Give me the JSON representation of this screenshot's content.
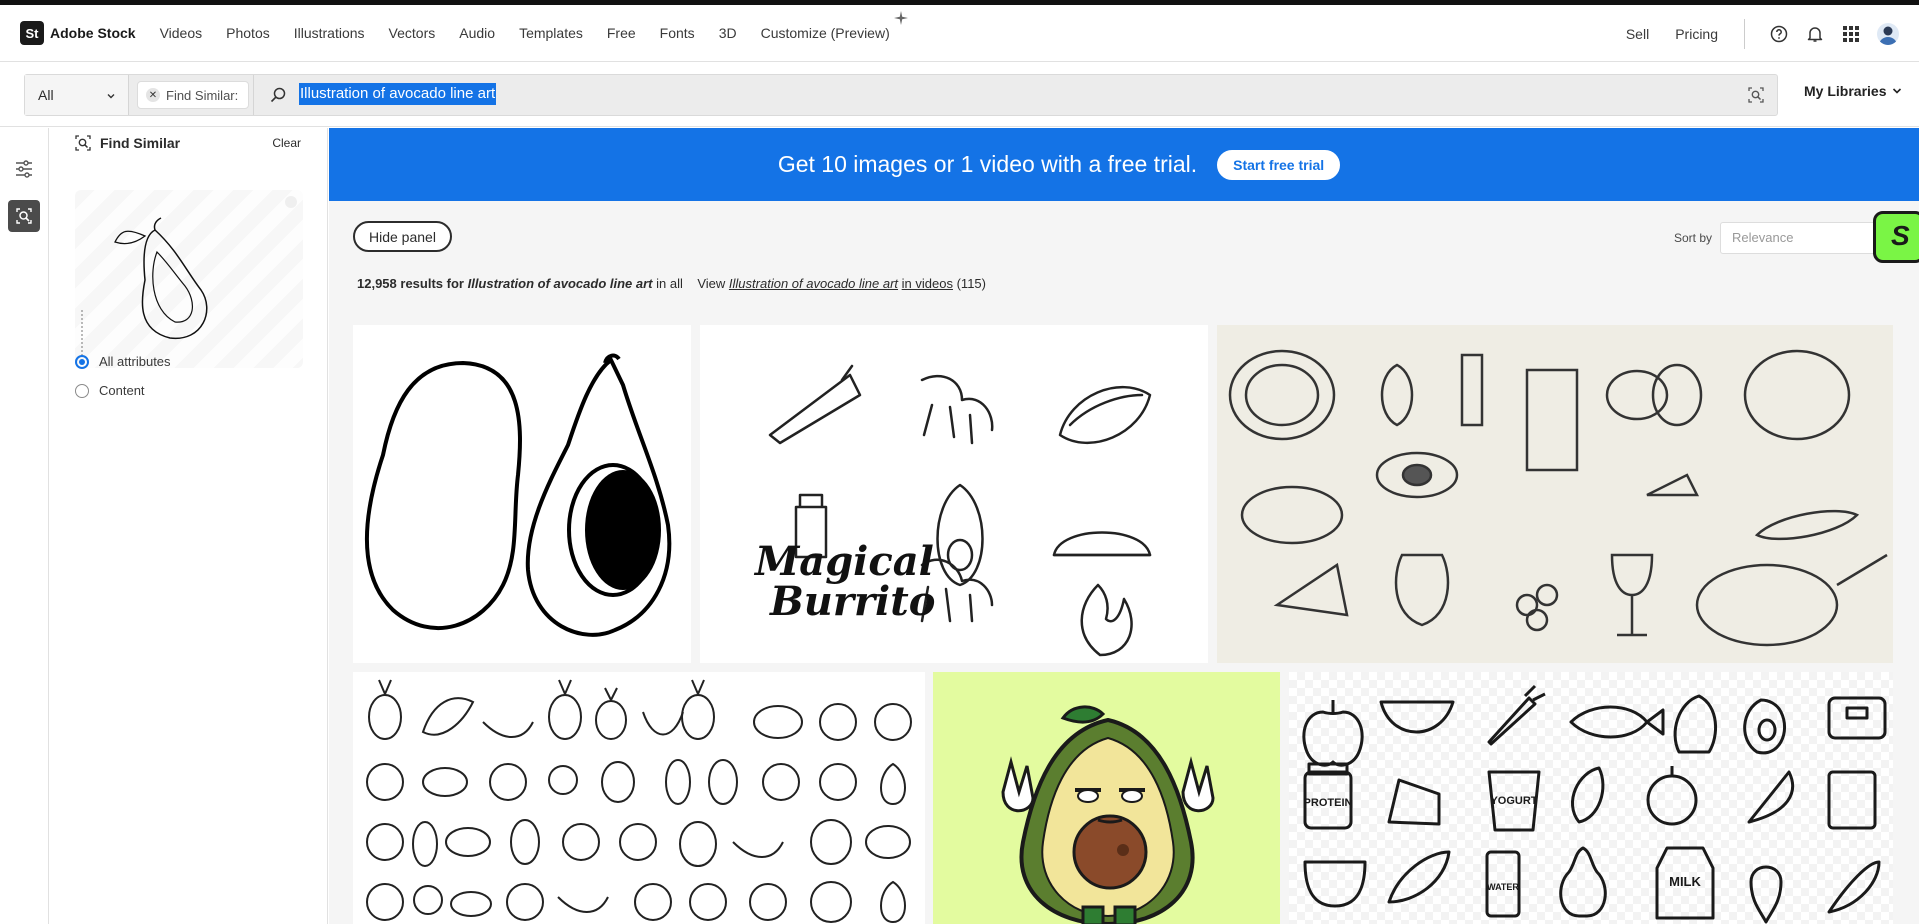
{
  "header": {
    "logo_mark": "St",
    "logo_text": "Adobe Stock",
    "nav": [
      "Videos",
      "Photos",
      "Illustrations",
      "Vectors",
      "Audio",
      "Templates",
      "Free",
      "Fonts",
      "3D",
      "Customize (Preview)"
    ],
    "sell": "Sell",
    "pricing": "Pricing",
    "icons": [
      "help-icon",
      "bell-icon",
      "apps-grid-icon",
      "avatar"
    ]
  },
  "search": {
    "scope": "All",
    "chip_label": "Find Similar:",
    "query": "Illustration of avocado line art",
    "my_libraries": "My Libraries"
  },
  "panel": {
    "title": "Find Similar",
    "clear": "Clear",
    "options": [
      {
        "label": "All attributes",
        "selected": true
      },
      {
        "label": "Content",
        "selected": false
      }
    ]
  },
  "banner": {
    "text": "Get 10 images or 1 video with a free trial.",
    "button": "Start free trial",
    "color": "#1473e6"
  },
  "toolbar": {
    "hide_panel": "Hide panel",
    "sort_label": "Sort by",
    "sort_value": "Relevance",
    "badge": "S"
  },
  "results": {
    "count": "12,958",
    "results_for": "results for",
    "query": "Illustration of avocado line art",
    "in_all": "in all",
    "view": "View",
    "in_videos": "in videos",
    "video_count": "(115)"
  },
  "tiles": {
    "burrito_text_1": "Magical",
    "burrito_text_2": "Burrito",
    "labels": [
      "PROTEIN",
      "YOGURT",
      "WATER",
      "MILK"
    ]
  }
}
